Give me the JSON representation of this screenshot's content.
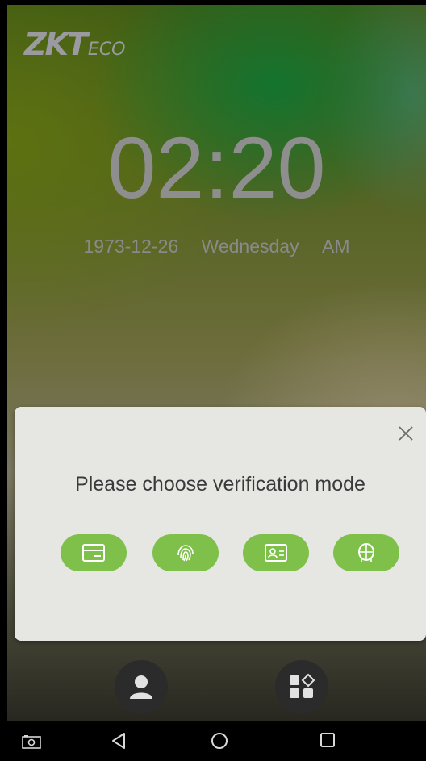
{
  "brand": {
    "logo_main": "ZKT",
    "logo_sub": "ECO"
  },
  "clock": {
    "time": "02:20",
    "date": "1973-12-26",
    "weekday": "Wednesday",
    "meridiem": "AM"
  },
  "dialog": {
    "prompt": "Please choose verification mode",
    "modes": [
      {
        "name": "card",
        "icon": "card-icon"
      },
      {
        "name": "fingerprint",
        "icon": "fingerprint-icon"
      },
      {
        "name": "id-badge",
        "icon": "id-card-icon"
      },
      {
        "name": "face",
        "icon": "face-icon"
      }
    ]
  },
  "bottom_buttons": [
    {
      "name": "user",
      "icon": "user-icon"
    },
    {
      "name": "menu",
      "icon": "apps-icon"
    }
  ],
  "navbar": [
    "camera-icon",
    "back-icon",
    "home-icon",
    "recents-icon"
  ],
  "colors": {
    "accent_green": "#7ec04a",
    "dialog_bg": "#e6e6e2",
    "text_gray": "#8e8e8e"
  }
}
